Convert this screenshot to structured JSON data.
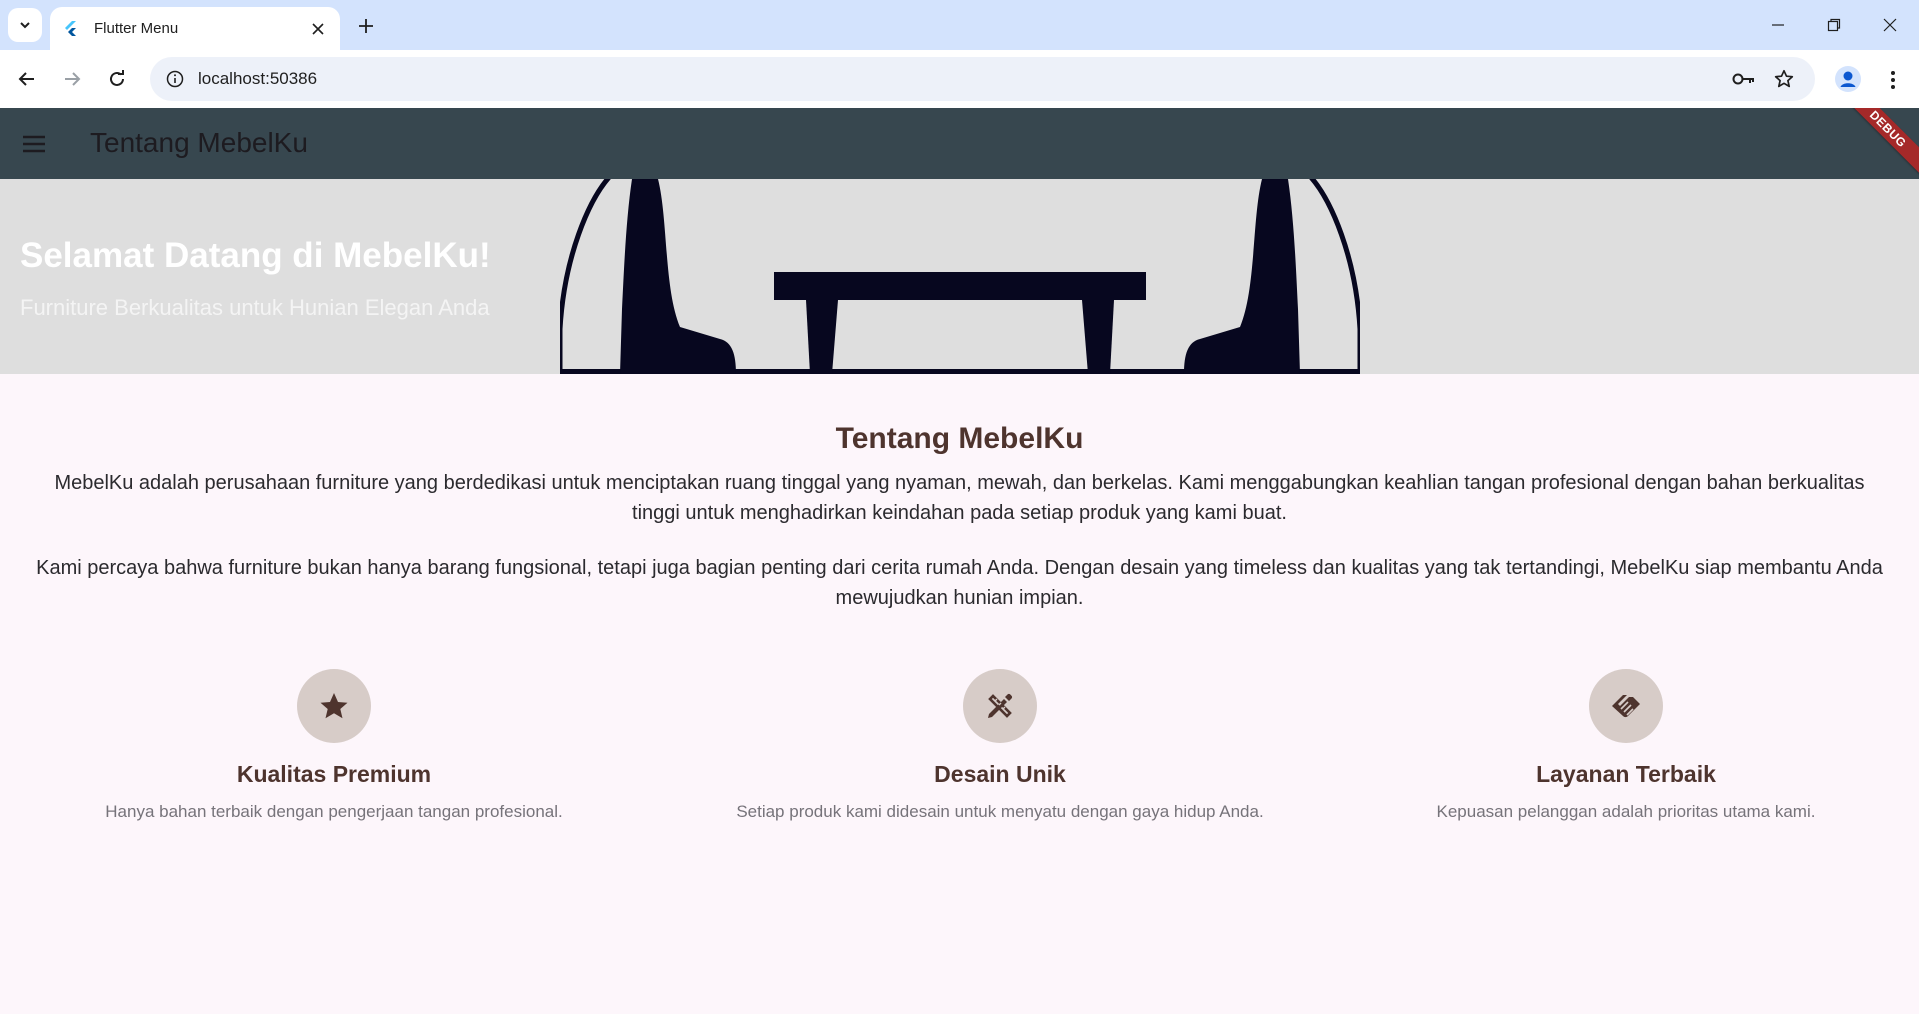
{
  "browser": {
    "tab_title": "Flutter Menu",
    "url": "localhost:50386"
  },
  "app": {
    "title": "Tentang MebelKu",
    "debug_banner": "DEBUG"
  },
  "hero": {
    "title": "Selamat Datang di MebelKu!",
    "subtitle": "Furniture Berkualitas untuk Hunian Elegan Anda"
  },
  "about": {
    "heading": "Tentang MebelKu",
    "paragraphs": [
      "MebelKu adalah perusahaan furniture yang berdedikasi untuk menciptakan ruang tinggal yang nyaman, mewah, dan berkelas. Kami menggabungkan keahlian tangan profesional dengan bahan berkualitas tinggi untuk menghadirkan keindahan pada setiap produk yang kami buat.",
      "Kami percaya bahwa furniture bukan hanya barang fungsional, tetapi juga bagian penting dari cerita rumah Anda. Dengan desain yang timeless dan kualitas yang tak tertandingi, MebelKu siap membantu Anda mewujudkan hunian impian."
    ]
  },
  "features": [
    {
      "icon": "star-icon",
      "title": "Kualitas Premium",
      "description": "Hanya bahan terbaik dengan pengerjaan tangan profesional."
    },
    {
      "icon": "design-services-icon",
      "title": "Desain Unik",
      "description": "Setiap produk kami didesain untuk menyatu dengan gaya hidup Anda."
    },
    {
      "icon": "handshake-icon",
      "title": "Layanan Terbaik",
      "description": "Kepuasan pelanggan adalah prioritas utama kami."
    }
  ],
  "colors": {
    "appbar": "#37474f",
    "accent_brown": "#4e342e",
    "icon_circle": "#d7ccc8",
    "page_background": "#fdf6fb",
    "hero_background": "#dedede"
  }
}
